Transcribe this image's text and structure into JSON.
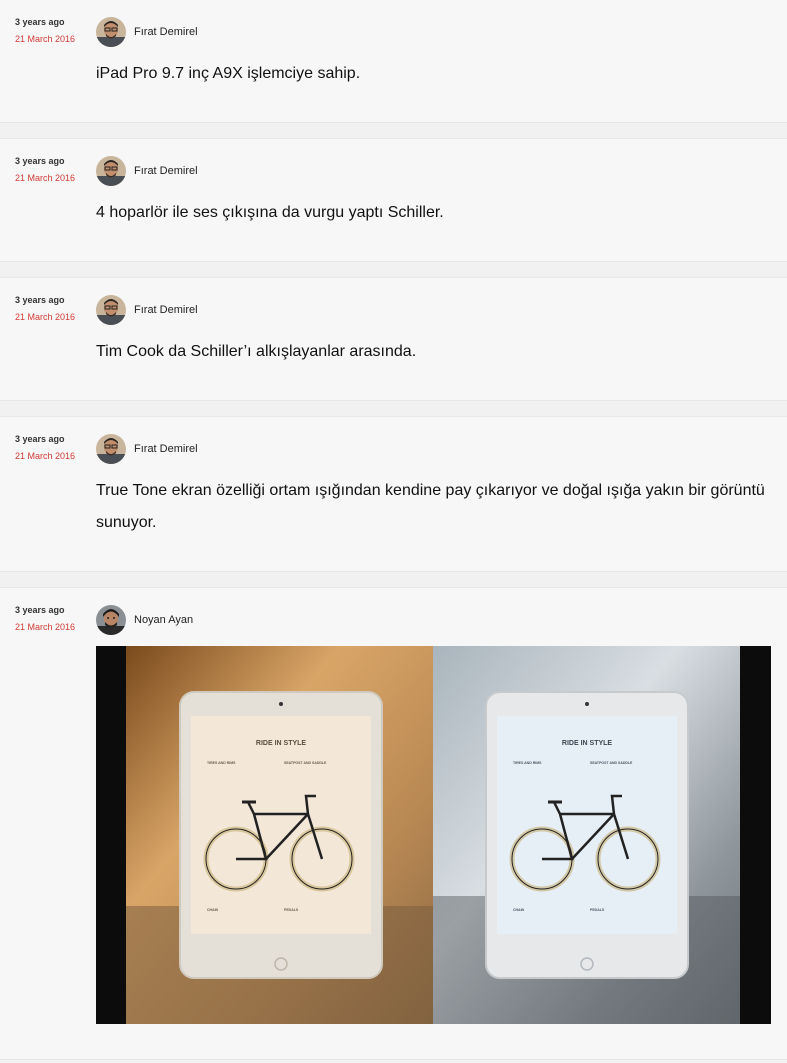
{
  "posts": [
    {
      "ago": "3 years ago",
      "date": "21 March 2016",
      "author": "Fırat Demirel",
      "text": "iPad Pro 9.7 inç A9X işlemciye sahip."
    },
    {
      "ago": "3 years ago",
      "date": "21 March 2016",
      "author": "Fırat Demirel",
      "text": "4 hoparlör ile ses çıkışına da vurgu yaptı Schiller."
    },
    {
      "ago": "3 years ago",
      "date": "21 March 2016",
      "author": "Fırat Demirel",
      "text": "Tim Cook da Schiller’ı alkışlayanlar arasında."
    },
    {
      "ago": "3 years ago",
      "date": "21 March 2016",
      "author": "Fırat Demirel",
      "text": "True Tone ekran özelliği ortam ışığından kendine pay çıkarıyor ve doğal ışığa yakın bir görüntü sunuyor."
    },
    {
      "ago": "3 years ago",
      "date": "21 March 2016",
      "author": "Noyan Ayan"
    }
  ],
  "image_screen": {
    "title": "RIDE IN STYLE",
    "sections": [
      "TIRES AND RIMS",
      "SEATPOST AND SADDLE",
      "CHAIN",
      "PEDALS"
    ]
  },
  "colors": {
    "date_red": "#d33b35",
    "warm_screen": "#f3e7d8",
    "cool_screen": "#e6eef6"
  }
}
